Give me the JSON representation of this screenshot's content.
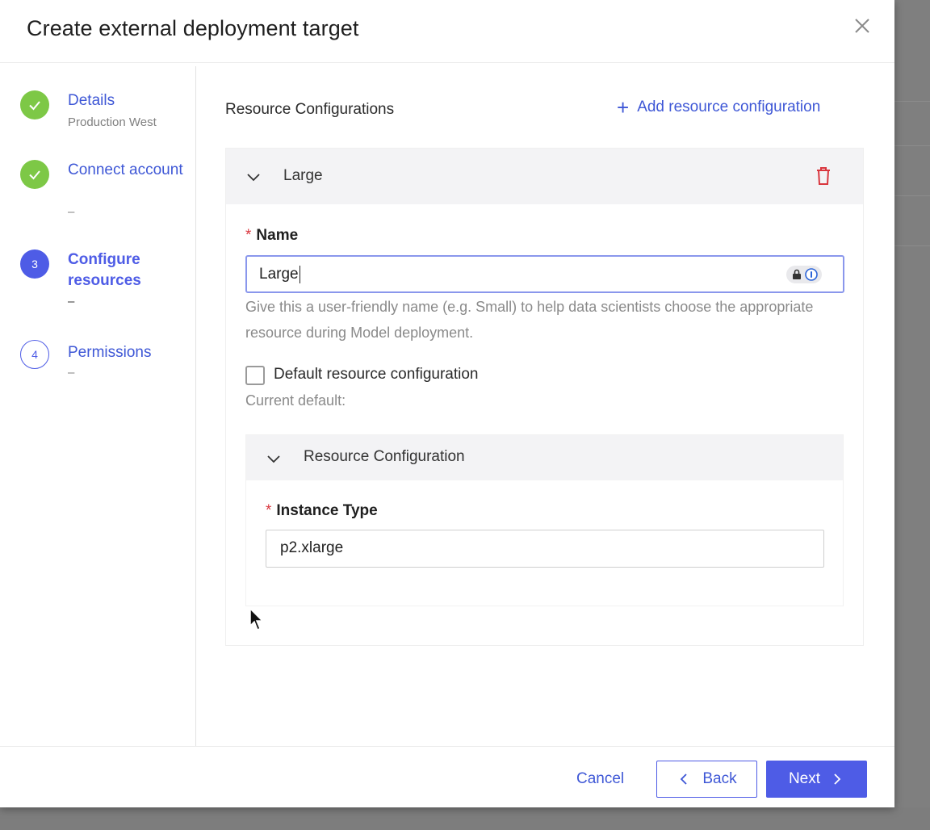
{
  "dialog": {
    "title": "Create external deployment target"
  },
  "steps": [
    {
      "title": "Details",
      "subtitle": "Production West",
      "status": "complete"
    },
    {
      "title": "Connect account",
      "subtitle": "–",
      "status": "complete"
    },
    {
      "number": "3",
      "title": "Configure resources",
      "subtitle": "–",
      "status": "active"
    },
    {
      "number": "4",
      "title": "Permissions",
      "subtitle": "–",
      "status": "pending"
    }
  ],
  "resources": {
    "section_title": "Resource Configurations",
    "add_label": "Add resource configuration",
    "config": {
      "header_label": "Large",
      "name_label": "Name",
      "name_value": "Large",
      "help_text": "Give this a user-friendly name (e.g. Small) to help data scientists choose the appropriate resource during Model deployment.",
      "default_checkbox_label": "Default resource configuration",
      "default_checked": false,
      "current_default": "Current default:",
      "sub_panel": {
        "header_label": "Resource Configuration",
        "instance_type_label": "Instance Type",
        "instance_type_value": "p2.xlarge"
      }
    }
  },
  "footer": {
    "cancel_label": "Cancel",
    "back_label": "Back",
    "next_label": "Next"
  },
  "colors": {
    "accent": "#4e5ce6",
    "link": "#3e57d6",
    "success": "#7dc846",
    "danger": "#d9363e"
  }
}
